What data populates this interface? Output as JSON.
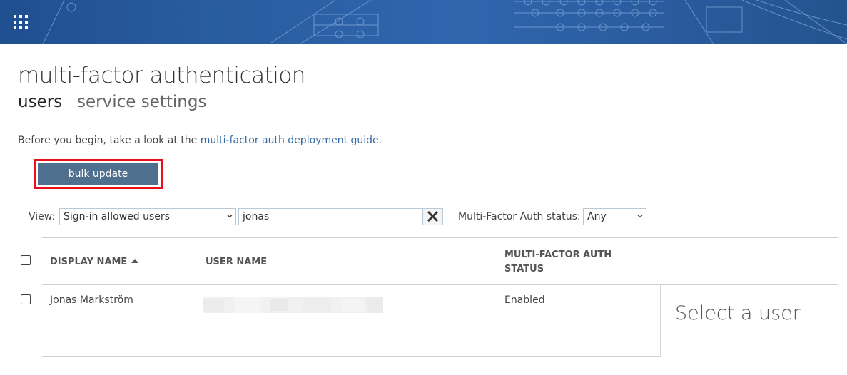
{
  "banner": {
    "app_launcher_icon": "waffle-grid-icon"
  },
  "page": {
    "title": "multi-factor authentication"
  },
  "tabs": [
    {
      "label": "users",
      "active": true
    },
    {
      "label": "service settings",
      "active": false
    }
  ],
  "intro": {
    "prefix": "Before you begin, take a look at the ",
    "link": "multi-factor auth deployment guide",
    "suffix": "."
  },
  "actions": {
    "bulk_update_label": "bulk update"
  },
  "filters": {
    "view_label": "View:",
    "view_value": "Sign-in allowed users",
    "search_value": "jonas",
    "clear_icon": "close-x-icon",
    "mfa_status_label": "Multi-Factor Auth status:",
    "mfa_status_value": "Any"
  },
  "table": {
    "headers": {
      "display_name": "DISPLAY NAME",
      "sort_icon": "sort-ascending-icon",
      "user_name": "USER NAME",
      "mfa_status_line1": "MULTI-FACTOR AUTH",
      "mfa_status_line2": "STATUS"
    },
    "rows": [
      {
        "display_name": "Jonas Markström",
        "user_name": "",
        "mfa_status": "Enabled"
      }
    ]
  },
  "detail_panel": {
    "placeholder": "Select a user"
  },
  "colors": {
    "banner": "#2a5ea3",
    "accent_button": "#4e6f8e",
    "link": "#2f6aa6",
    "highlight": "#e8101c"
  }
}
